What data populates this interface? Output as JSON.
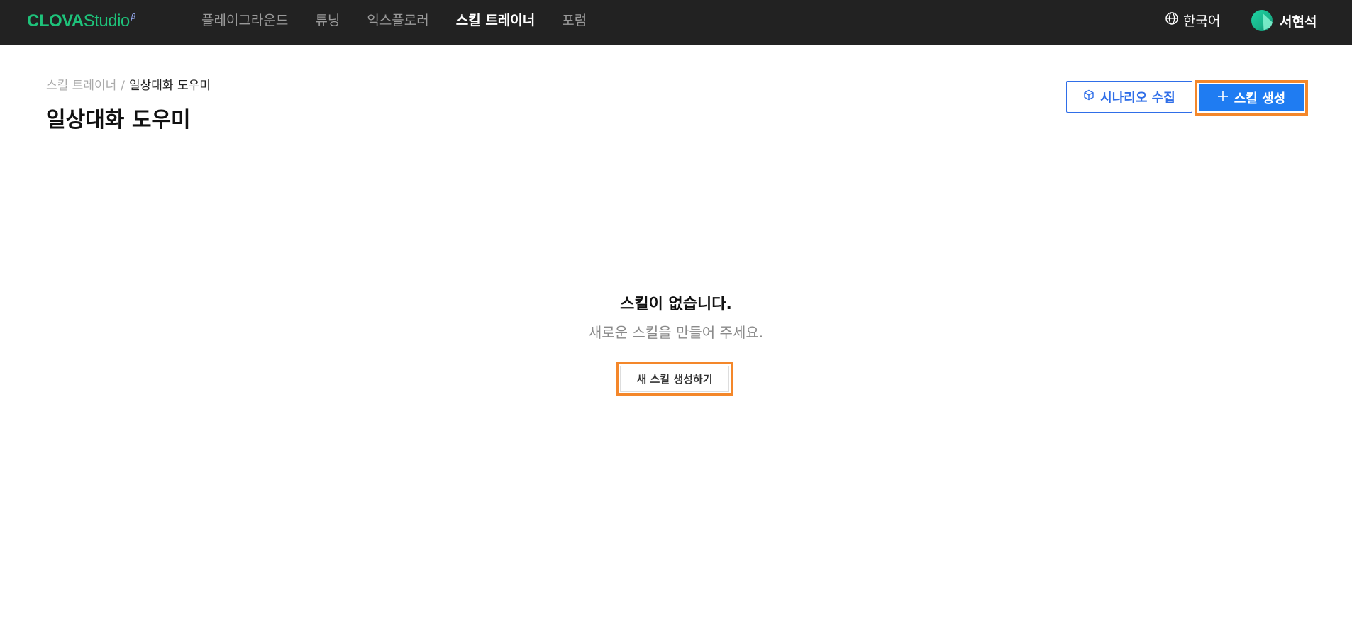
{
  "app": {
    "logo": {
      "main": "CLOVA",
      "sub": "Studio",
      "beta": "β"
    }
  },
  "nav": {
    "items": [
      {
        "label": "플레이그라운드",
        "active": false
      },
      {
        "label": "튜닝",
        "active": false
      },
      {
        "label": "익스플로러",
        "active": false
      },
      {
        "label": "스킬 트레이너",
        "active": true
      },
      {
        "label": "포럼",
        "active": false
      }
    ]
  },
  "header": {
    "language": "한국어",
    "user_name": "서현석"
  },
  "breadcrumb": {
    "parent": "스킬 트레이너",
    "separator": "/",
    "current": "일상대화 도우미"
  },
  "page": {
    "title": "일상대화 도우미",
    "scenario_button": "시나리오 수집",
    "create_button": "스킬 생성"
  },
  "empty_state": {
    "title": "스킬이 없습니다.",
    "subtitle": "새로운 스킬을 만들어 주세요.",
    "button": "새 스킬 생성하기"
  },
  "colors": {
    "topbar": "#222222",
    "brand_green": "#1ec27a",
    "primary_blue": "#1f7cf2",
    "highlight_orange": "#f4872a"
  }
}
